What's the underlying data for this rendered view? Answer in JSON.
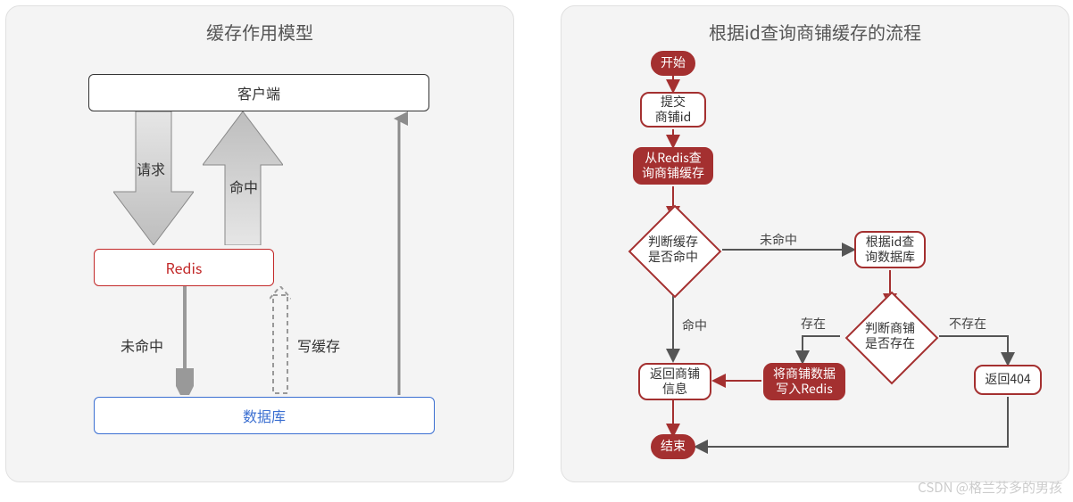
{
  "left": {
    "title": "缓存作用模型",
    "client": "客户端",
    "redis": "Redis",
    "db": "数据库",
    "arrow_request": "请求",
    "arrow_hit": "命中",
    "arrow_miss": "未命中",
    "arrow_write_cache": "写缓存"
  },
  "right": {
    "title": "根据id查询商铺缓存的流程",
    "start": "开始",
    "submit_id_l1": "提交",
    "submit_id_l2": "商铺id",
    "query_redis_l1": "从Redis查",
    "query_redis_l2": "询商铺缓存",
    "decide_cache_l1": "判断缓存",
    "decide_cache_l2": "是否命中",
    "edge_miss": "未命中",
    "edge_hit": "命中",
    "query_db_l1": "根据id查",
    "query_db_l2": "询数据库",
    "decide_shop_l1": "判断商铺",
    "decide_shop_l2": "是否存在",
    "edge_exists": "存在",
    "edge_not_exists": "不存在",
    "write_redis_l1": "将商铺数据",
    "write_redis_l2": "写入Redis",
    "return_info_l1": "返回商铺",
    "return_info_l2": "信息",
    "return_404": "返回404",
    "end": "结束"
  },
  "watermark": "CSDN @格兰芬多的男孩"
}
